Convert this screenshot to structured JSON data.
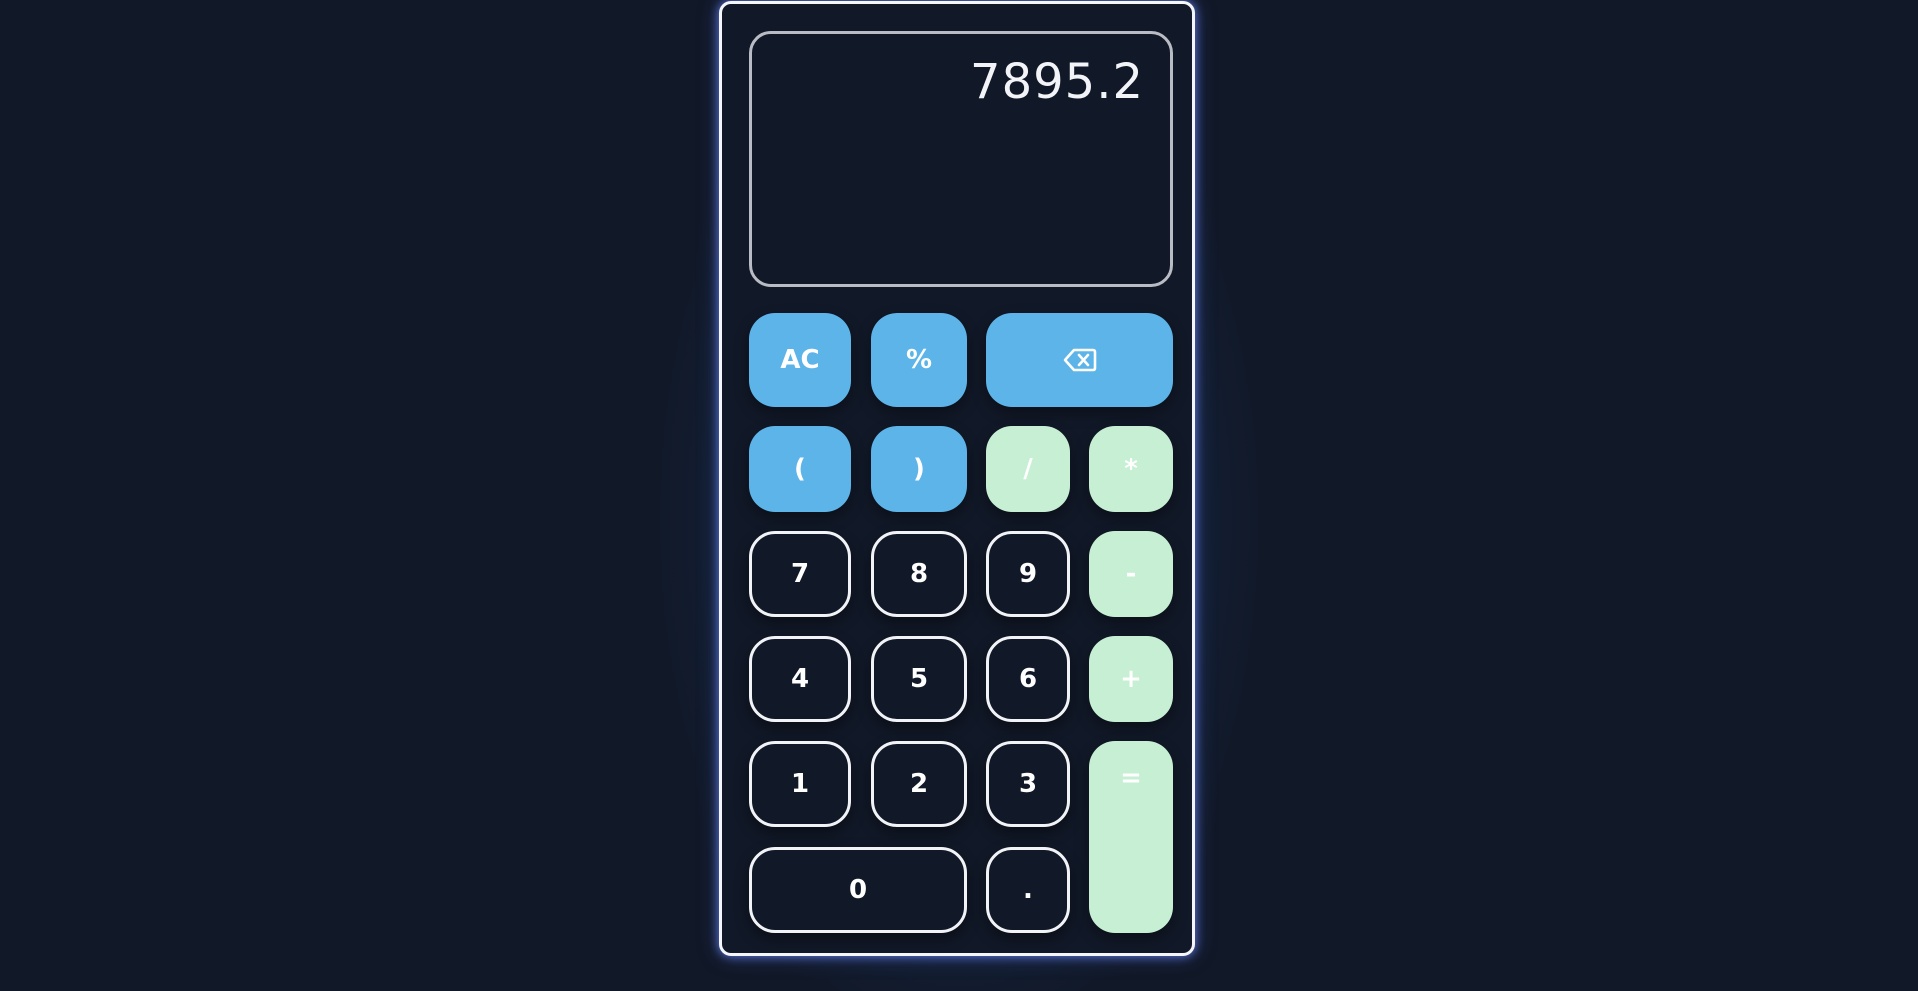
{
  "display": {
    "value": "7895.2"
  },
  "keys": {
    "ac": "AC",
    "percent": "%",
    "backspace_icon": "backspace-icon",
    "open_paren": "(",
    "close_paren": ")",
    "divide": "/",
    "multiply": "*",
    "seven": "7",
    "eight": "8",
    "nine": "9",
    "minus": "-",
    "four": "4",
    "five": "5",
    "six": "6",
    "plus": "+",
    "one": "1",
    "two": "2",
    "three": "3",
    "equals": "=",
    "zero": "0",
    "decimal": "."
  },
  "colors": {
    "background": "#111827",
    "function_key": "#5db4e8",
    "operator_key": "#c6efd4",
    "frame_glow": "#6e8cff"
  }
}
